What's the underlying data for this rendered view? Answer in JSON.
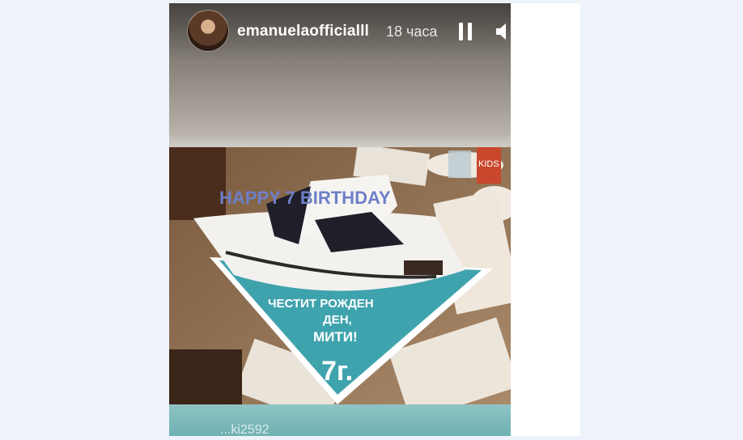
{
  "story": {
    "username": "emanuelaofficialll",
    "time": "18 часа",
    "tag_text": "...ki2592"
  },
  "cake": {
    "candles": "HAPPY 7 BIRTHDAY",
    "line1": "ЧЕСТИТ РОЖДЕН",
    "line2": "ДЕН,",
    "line3": "МИТИ!",
    "age": "7г.",
    "kids_label": "KIDS"
  },
  "icons": {
    "pause": "pause-icon",
    "volume": "volume-icon"
  },
  "colors": {
    "page_background": "#eef3fb",
    "cake_base": "#3fa3ad",
    "text_white": "#ffffff"
  }
}
